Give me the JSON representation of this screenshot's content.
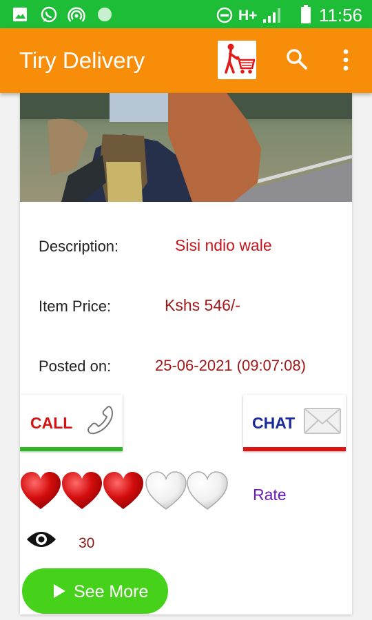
{
  "status_bar": {
    "time": "11:56",
    "network": "H+",
    "icons": [
      "image-icon",
      "whatsapp-icon",
      "hotspot-icon",
      "notification-dot-icon",
      "do-not-disturb-icon",
      "signal-icon",
      "battery-icon"
    ]
  },
  "app_bar": {
    "title": "Tiry Delivery",
    "icons": [
      "cart-person-logo-icon",
      "search-icon",
      "more-vert-icon"
    ]
  },
  "listing": {
    "description_label": "Description:",
    "description_value": "Sisi ndio wale",
    "price_label": "Item Price:",
    "price_value": "Kshs 546/-",
    "posted_label": "Posted on:",
    "posted_value": "25-06-2021 (09:07:08)"
  },
  "actions": {
    "call_label": "CALL",
    "chat_label": "CHAT"
  },
  "rating": {
    "filled_hearts": 3,
    "total_hearts": 5,
    "rate_label": "Rate"
  },
  "views": {
    "count": "30"
  },
  "see_more": {
    "label": "See More"
  },
  "colors": {
    "status_bar": "#1ebd38",
    "app_bar": "#f88d0a",
    "value_text": "#c8151b",
    "call_accent": "#2fb72a",
    "chat_accent": "#e01414",
    "rate_text": "#6a1bb5",
    "see_more_bg": "#46d11a"
  }
}
